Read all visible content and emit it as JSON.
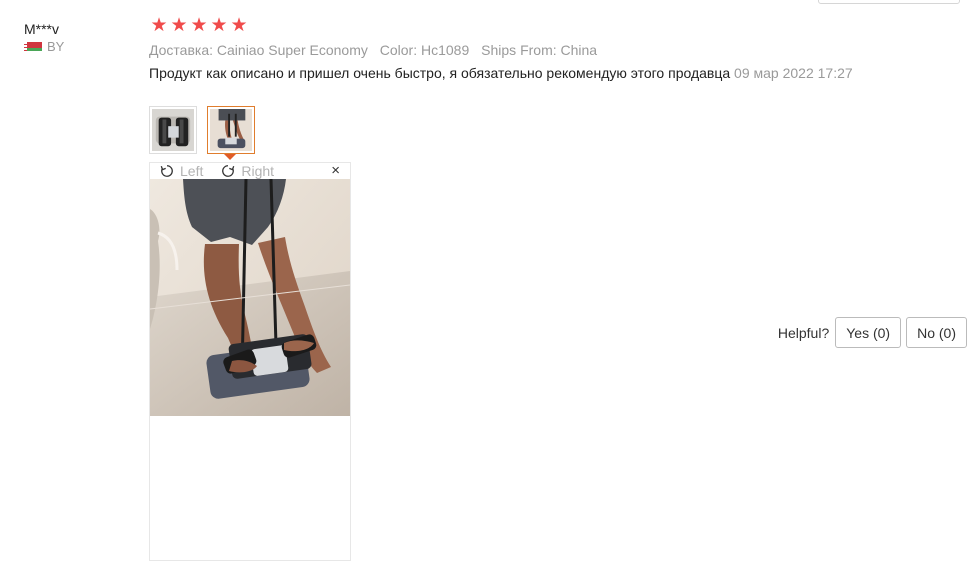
{
  "review": {
    "reviewer": {
      "name": "M***v",
      "country": "BY"
    },
    "rating": 5,
    "meta": {
      "delivery": "Доставка: Cainiao Super Economy",
      "color": "Color: Hc1089",
      "ships_from": "Ships From: China"
    },
    "text": "Продукт как описано и пришел очень быстро, я обязательно рекомендую этого продавца",
    "date": "09 мар 2022 17:27"
  },
  "image_viewer": {
    "left_label": "Left",
    "right_label": "Right",
    "close_label": "×",
    "selected_thumbnail": 2
  },
  "helpful": {
    "label": "Helpful?",
    "yes": "Yes (0)",
    "no": "No (0)"
  },
  "colors": {
    "star": "#f04b4b",
    "thumbnail_active": "#e07d2d",
    "meta_text": "#9a9a9a"
  },
  "icons": {
    "rotate_left": "rotate-left-icon",
    "rotate_right": "rotate-right-icon",
    "close": "close-icon",
    "flag": "belarus-flag-icon",
    "star": "star-icon"
  }
}
